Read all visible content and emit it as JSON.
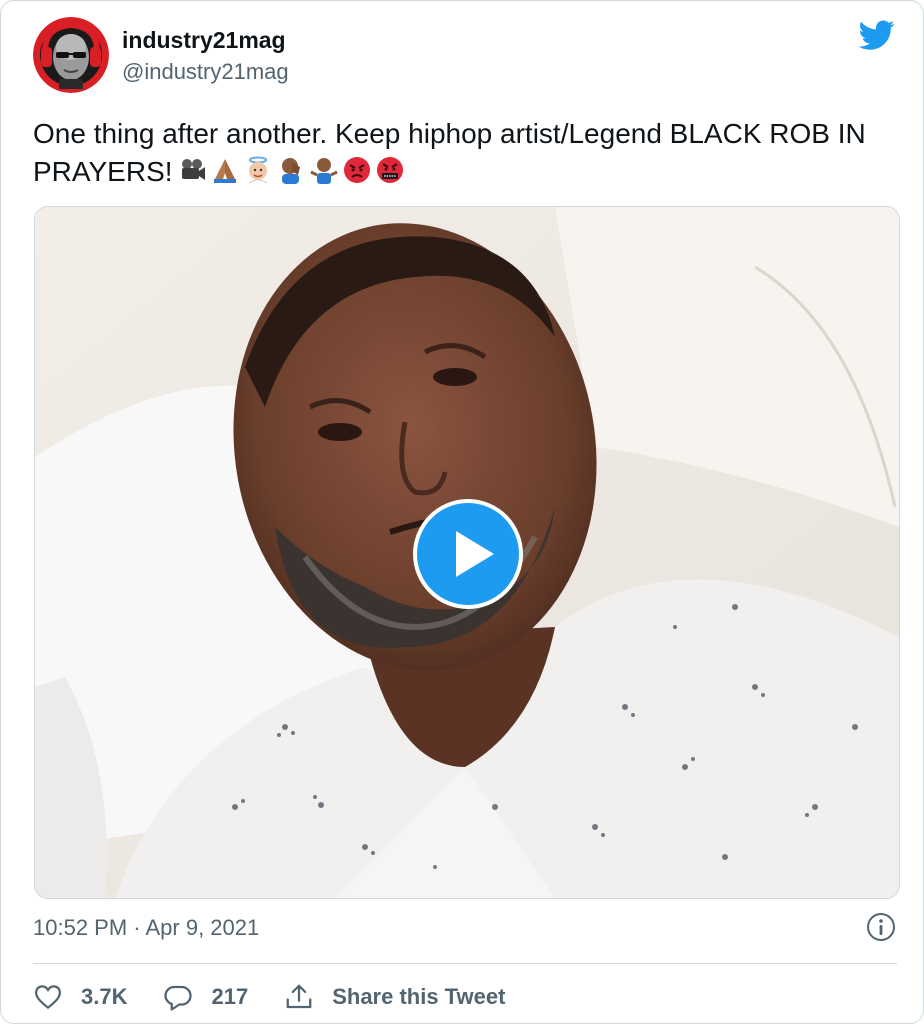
{
  "tweet": {
    "author": {
      "display_name": "industry21mag",
      "handle": "@industry21mag",
      "avatar_icon": "bald-man-headphones-avatar"
    },
    "text": "One thing after another. Keep hiphop artist/Legend BLACK ROB IN PRAYERS!",
    "emojis": [
      "movie-camera-emoji",
      "folded-hands-emoji",
      "angel-emoji",
      "person-facepalming-emoji",
      "person-shrugging-emoji",
      "angry-face-emoji",
      "face-with-symbols-emoji"
    ],
    "media": {
      "type": "video",
      "thumbnail_icon": "man-in-hospital-bed",
      "play_icon": "play-button-icon"
    },
    "timestamp": "10:52 PM · Apr 9, 2021",
    "actions": {
      "likes": "3.7K",
      "replies": "217",
      "share_label": "Share this Tweet"
    }
  },
  "colors": {
    "accent": "#1d9bf0",
    "text_primary": "#0f1419",
    "text_secondary": "#536471",
    "border": "#cfd9de",
    "angry_red": "#e0283a"
  }
}
